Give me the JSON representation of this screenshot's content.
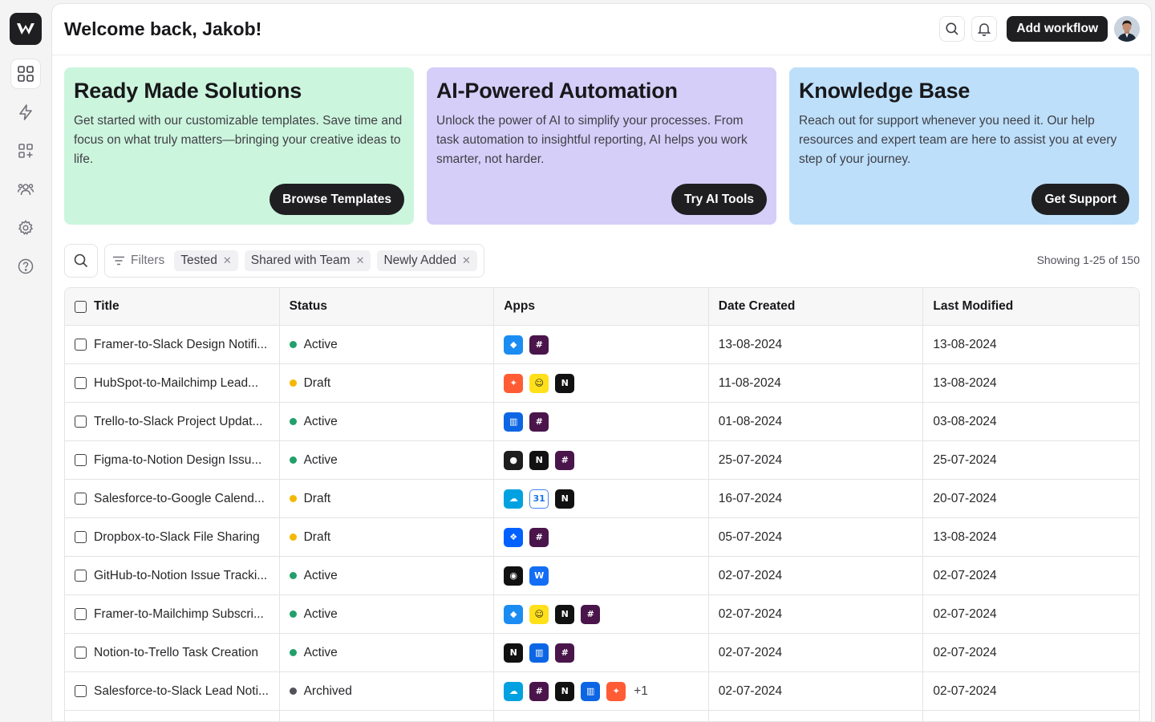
{
  "header": {
    "welcome": "Welcome back, Jakob!",
    "add_workflow": "Add workflow"
  },
  "sidebar": {
    "items": [
      "dashboard",
      "automations",
      "integrations",
      "team",
      "settings",
      "help"
    ]
  },
  "cards": [
    {
      "title": "Ready Made Solutions",
      "body": "Get started with our customizable templates. Save time and focus on what truly matters—bringing your creative ideas to life.",
      "button": "Browse Templates",
      "color": "#ccf5dd"
    },
    {
      "title": "AI-Powered Automation",
      "body": "Unlock the power of AI to simplify your processes. From task automation to insightful reporting, AI helps you work smarter, not harder.",
      "button": "Try AI Tools",
      "color": "#d5cef8"
    },
    {
      "title": "Knowledge Base",
      "body": "Reach out for support whenever you need it. Our help resources and expert team are here to assist you at every step of your journey.",
      "button": "Get Support",
      "color": "#bddffa"
    }
  ],
  "filters": {
    "label": "Filters",
    "chips": [
      "Tested",
      "Shared with Team",
      "Newly Added"
    ],
    "showing": "Showing 1-25 of 150"
  },
  "table": {
    "columns": [
      "Title",
      "Status",
      "Apps",
      "Date Created",
      "Last Modified"
    ],
    "status_colors": {
      "Active": "#22a06b",
      "Draft": "#f5b800",
      "Archived": "#52525b"
    },
    "rows": [
      {
        "title": "Framer-to-Slack Design Notifi...",
        "status": "Active",
        "apps": [
          "framer",
          "slack"
        ],
        "extra": "",
        "created": "13-08-2024",
        "modified": "13-08-2024"
      },
      {
        "title": "HubSpot-to-Mailchimp Lead...",
        "status": "Draft",
        "apps": [
          "hubspot",
          "mailchimp",
          "notion"
        ],
        "extra": "",
        "created": "11-08-2024",
        "modified": "13-08-2024"
      },
      {
        "title": "Trello-to-Slack Project Updat...",
        "status": "Active",
        "apps": [
          "trello",
          "slack"
        ],
        "extra": "",
        "created": "01-08-2024",
        "modified": "03-08-2024"
      },
      {
        "title": "Figma-to-Notion Design Issu...",
        "status": "Active",
        "apps": [
          "figma",
          "notion",
          "slack"
        ],
        "extra": "",
        "created": "25-07-2024",
        "modified": "25-07-2024"
      },
      {
        "title": "Salesforce-to-Google Calend...",
        "status": "Draft",
        "apps": [
          "salesforce",
          "gcal",
          "notion"
        ],
        "extra": "",
        "created": "16-07-2024",
        "modified": "20-07-2024"
      },
      {
        "title": "Dropbox-to-Slack File Sharing",
        "status": "Draft",
        "apps": [
          "dropbox",
          "slack"
        ],
        "extra": "",
        "created": "05-07-2024",
        "modified": "13-08-2024"
      },
      {
        "title": "GitHub-to-Notion Issue Tracki...",
        "status": "Active",
        "apps": [
          "github",
          "webflow"
        ],
        "extra": "",
        "created": "02-07-2024",
        "modified": "02-07-2024"
      },
      {
        "title": "Framer-to-Mailchimp Subscri...",
        "status": "Active",
        "apps": [
          "framer",
          "mailchimp",
          "notion",
          "slack"
        ],
        "extra": "",
        "created": "02-07-2024",
        "modified": "02-07-2024"
      },
      {
        "title": "Notion-to-Trello Task Creation",
        "status": "Active",
        "apps": [
          "notion",
          "trello",
          "slack"
        ],
        "extra": "",
        "created": "02-07-2024",
        "modified": "02-07-2024"
      },
      {
        "title": "Salesforce-to-Slack Lead Noti...",
        "status": "Archived",
        "apps": [
          "salesforce",
          "slack",
          "notion",
          "trello",
          "hubspot"
        ],
        "extra": "+1",
        "created": "02-07-2024",
        "modified": "02-07-2024"
      },
      {
        "title": "",
        "status": "",
        "apps": [],
        "extra": "",
        "created": "",
        "modified": ""
      }
    ]
  }
}
